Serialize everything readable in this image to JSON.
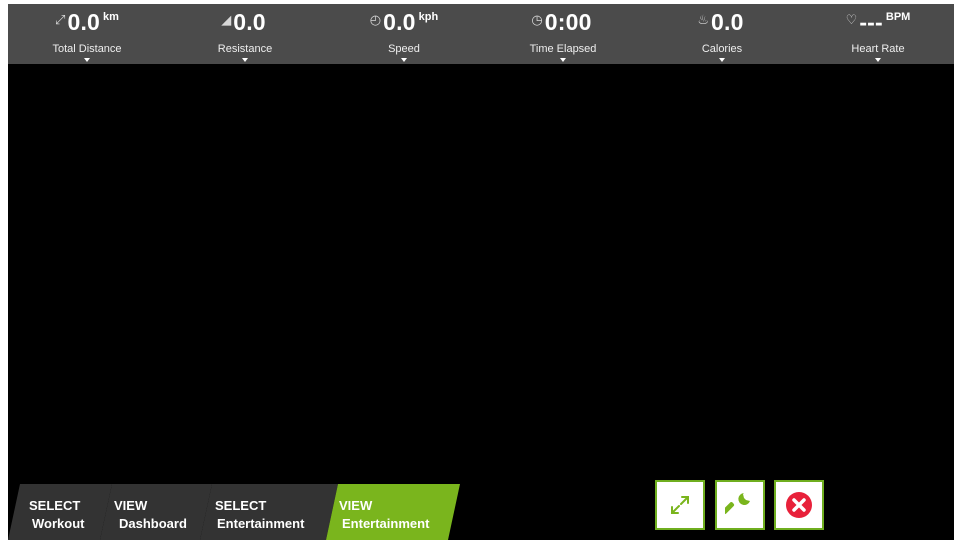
{
  "stats": [
    {
      "icon": "distance-icon",
      "glyph": "⤢",
      "value": "0.0",
      "unit": "km",
      "label": "Total Distance"
    },
    {
      "icon": "resistance-icon",
      "glyph": "◢",
      "value": "0.0",
      "unit": "",
      "label": "Resistance"
    },
    {
      "icon": "speedometer-icon",
      "glyph": "◴",
      "value": "0.0",
      "unit": "kph",
      "label": "Speed"
    },
    {
      "icon": "stopwatch-icon",
      "glyph": "◷",
      "value": "0:00",
      "unit": "",
      "label": "Time Elapsed"
    },
    {
      "icon": "flame-icon",
      "glyph": "♨",
      "value": "0.0",
      "unit": "",
      "label": "Calories"
    },
    {
      "icon": "heart-icon",
      "glyph": "♡",
      "value": "---",
      "unit": "BPM",
      "label": "Heart Rate"
    }
  ],
  "tabs": [
    {
      "line1": "SELECT",
      "line2": "Workout",
      "active": false
    },
    {
      "line1": "VIEW",
      "line2": "Dashboard",
      "active": false
    },
    {
      "line1": "SELECT",
      "line2": "Entertainment",
      "active": false
    },
    {
      "line1": "VIEW",
      "line2": "Entertainment",
      "active": true
    }
  ],
  "controls": [
    {
      "name": "fullscreen-button",
      "icon": "expand-icon"
    },
    {
      "name": "settings-button",
      "icon": "wrench-icon"
    },
    {
      "name": "close-button",
      "icon": "close-icon"
    }
  ],
  "colors": {
    "accent": "#7ab51d",
    "topbar": "#4b4b4b",
    "tab": "#333333",
    "close": "#e8213a"
  }
}
